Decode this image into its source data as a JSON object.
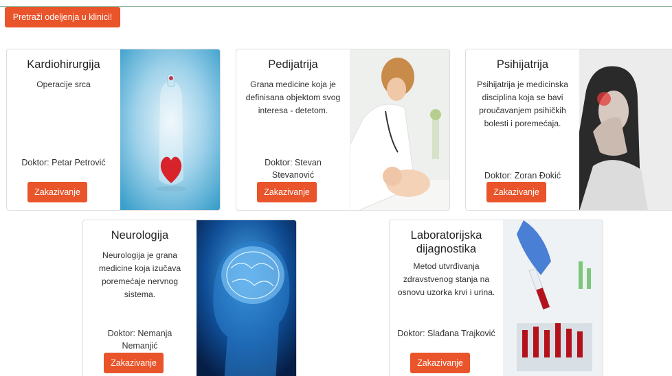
{
  "header": {
    "search_button_label": "Pretraži odeljenja u klinici!"
  },
  "cards": [
    {
      "title": "Kardiohirurgija",
      "description": "Operacije srca",
      "doctor": "Doktor: Petar Petrović",
      "button_label": "Zakazivanje",
      "image": "heart-in-bottle-photo"
    },
    {
      "title": "Pedijatrija",
      "description": "Grana medicine koja je definisana objektom svog interesa - detetom.",
      "doctor": "Doktor: Stevan Stevanović",
      "button_label": "Zakazivanje",
      "image": "doctor-examining-baby-photo"
    },
    {
      "title": "Psihijatrija",
      "description": "Psihijatrija je medicinska disciplina koja se bavi proučavanjem psihičkih bolesti i poremećaja.",
      "doctor": "Doktor: Zoran Đokić",
      "button_label": "Zakazivanje",
      "image": "woman-headache-photo"
    },
    {
      "title": "Neurologija",
      "description": "Neurologija je grana medicine koja izučava poremećaje nervnog sistema.",
      "doctor": "Doktor: Nemanja Nemanjić",
      "button_label": "Zakazivanje",
      "image": "glowing-brain-photo"
    },
    {
      "title": "Laboratorijska dijagnostika",
      "description": "Metod utvrđivanja zdravstvenog stanja na osnovu uzorka krvi i urina.",
      "doctor": "Doktor: Slađana Trajković",
      "button_label": "Zakazivanje",
      "image": "blood-test-tubes-photo"
    }
  ],
  "colors": {
    "accent": "#e9542a",
    "card_border": "#dddddd"
  }
}
